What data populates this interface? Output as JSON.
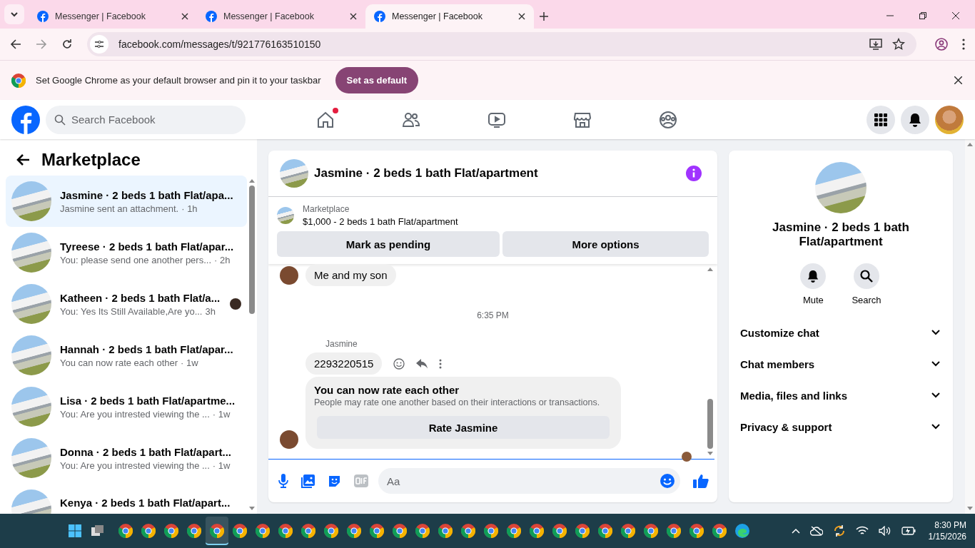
{
  "browser": {
    "tabs": [
      {
        "title": "Messenger | Facebook",
        "selected": false
      },
      {
        "title": "Messenger | Facebook",
        "selected": false
      },
      {
        "title": "Messenger | Facebook",
        "selected": true
      }
    ],
    "url": "facebook.com/messages/t/921776163510150",
    "infobar": {
      "text": "Set Google Chrome as your default browser and pin it to your taskbar",
      "button": "Set as default"
    }
  },
  "header": {
    "search_placeholder": "Search Facebook",
    "nav": [
      {
        "kind": "home",
        "badge": true
      },
      {
        "kind": "friends",
        "badge": false
      },
      {
        "kind": "video",
        "badge": false
      },
      {
        "kind": "marketplace",
        "badge": false
      },
      {
        "kind": "groups",
        "badge": false
      }
    ]
  },
  "sidebar": {
    "title": "Marketplace",
    "conversations": [
      {
        "title": "Jasmine · 2 beds 1 bath Flat/apa...",
        "preview": "Jasmine sent an attachment.",
        "time": "· 1h",
        "selected": true,
        "seen": false
      },
      {
        "title": "Tyreese · 2 beds 1 bath Flat/apar...",
        "preview": "You: please send one another pers...",
        "time": "· 2h",
        "selected": false,
        "seen": false
      },
      {
        "title": "Katheen · 2 beds 1 bath Flat/a...",
        "preview": "You: Yes Its Still Available,Are yo...",
        "time": "3h",
        "selected": false,
        "seen": true
      },
      {
        "title": "Hannah · 2 beds 1 bath Flat/apar...",
        "preview": "You can now rate each other",
        "time": "· 1w",
        "selected": false,
        "seen": false
      },
      {
        "title": "Lisa · 2 beds 1 bath Flat/apartme...",
        "preview": "You: Are you intrested viewing the ...",
        "time": "· 1w",
        "selected": false,
        "seen": false
      },
      {
        "title": "Donna · 2 beds 1 bath Flat/apart...",
        "preview": "You: Are you intrested viewing the ...",
        "time": "· 1w",
        "selected": false,
        "seen": false
      },
      {
        "title": "Kenya · 2 beds 1 bath Flat/apart...",
        "selected": false,
        "seen": false
      }
    ]
  },
  "chat": {
    "title": "Jasmine · 2 beds 1 bath Flat/apartment",
    "listing": {
      "label": "Marketplace",
      "summary": "$1,000 - 2 beds 1 bath Flat/apartment",
      "buttons": [
        "Mark as pending",
        "More options"
      ]
    },
    "messages": [
      {
        "kind": "text",
        "text": "Me and my son",
        "avatar": true,
        "actions": false
      },
      {
        "kind": "time",
        "text": "6:35 PM"
      },
      {
        "kind": "text",
        "sender": "Jasmine",
        "text": "2293220515",
        "avatar": false,
        "actions": true
      },
      {
        "kind": "rating",
        "title": "You can now rate each other",
        "text": "People may rate one another based on their interactions or transactions.",
        "button": "Rate Jasmine",
        "avatar": true
      }
    ],
    "seen": true,
    "composer": {
      "placeholder": "Aa"
    }
  },
  "details": {
    "name": "Jasmine · 2 beds 1 bath Flat/apartment",
    "actions": [
      {
        "kind": "mute",
        "label": "Mute"
      },
      {
        "kind": "search",
        "label": "Search"
      }
    ],
    "sections": [
      {
        "label": "Customize chat",
        "expanded": false
      },
      {
        "label": "Chat members",
        "expanded": false
      },
      {
        "label": "Media, files and links",
        "expanded": false
      },
      {
        "label": "Privacy & support",
        "expanded": false
      }
    ]
  },
  "taskbar": {
    "apps": [
      {
        "kind": "chrome",
        "selected": false
      },
      {
        "kind": "chrome",
        "selected": false
      },
      {
        "kind": "chrome",
        "selected": false
      },
      {
        "kind": "chrome",
        "selected": false
      },
      {
        "kind": "chrome",
        "selected": true
      },
      {
        "kind": "chrome",
        "selected": false
      },
      {
        "kind": "chrome",
        "selected": false
      },
      {
        "kind": "chrome",
        "selected": false
      },
      {
        "kind": "chrome",
        "selected": false
      },
      {
        "kind": "chrome",
        "selected": false
      },
      {
        "kind": "chrome",
        "selected": false
      },
      {
        "kind": "chrome",
        "selected": false
      },
      {
        "kind": "chrome",
        "selected": false
      },
      {
        "kind": "chrome",
        "selected": false
      },
      {
        "kind": "chrome",
        "selected": false
      },
      {
        "kind": "chrome",
        "selected": false
      },
      {
        "kind": "chrome",
        "selected": false
      },
      {
        "kind": "chrome",
        "selected": false
      },
      {
        "kind": "chrome",
        "selected": false
      },
      {
        "kind": "chrome",
        "selected": false
      },
      {
        "kind": "chrome",
        "selected": false
      },
      {
        "kind": "chrome",
        "selected": false
      },
      {
        "kind": "chrome",
        "selected": false
      },
      {
        "kind": "chrome",
        "selected": false
      },
      {
        "kind": "chrome",
        "selected": false
      },
      {
        "kind": "chrome",
        "selected": false
      },
      {
        "kind": "chrome",
        "selected": false
      },
      {
        "kind": "edge",
        "selected": false
      }
    ],
    "time": "8:30 PM",
    "date": "1/15/2026"
  }
}
